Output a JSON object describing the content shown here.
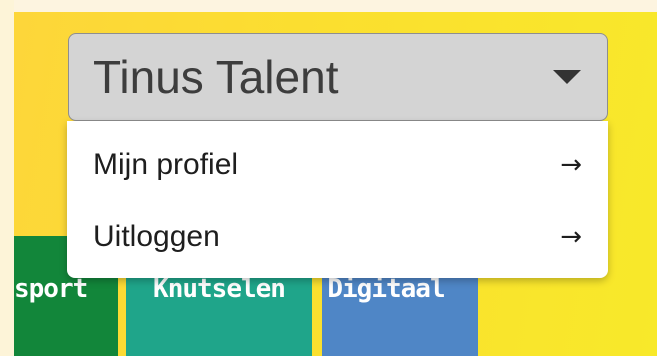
{
  "user_menu": {
    "username": "Tinus Talent",
    "caret_icon": "caret-down-icon",
    "items": [
      {
        "label": "Mijn profiel",
        "arrow": "→"
      },
      {
        "label": "Uitloggen",
        "arrow": "→"
      }
    ]
  },
  "categories": [
    {
      "label": "sport",
      "color": "#12863a"
    },
    {
      "label": "Knutselen",
      "color": "#1fa58a"
    },
    {
      "label": "Digitaal",
      "color": "#4f86c6"
    }
  ],
  "colors": {
    "panel": "#fbdf2f",
    "select": "#d4d4d4"
  }
}
